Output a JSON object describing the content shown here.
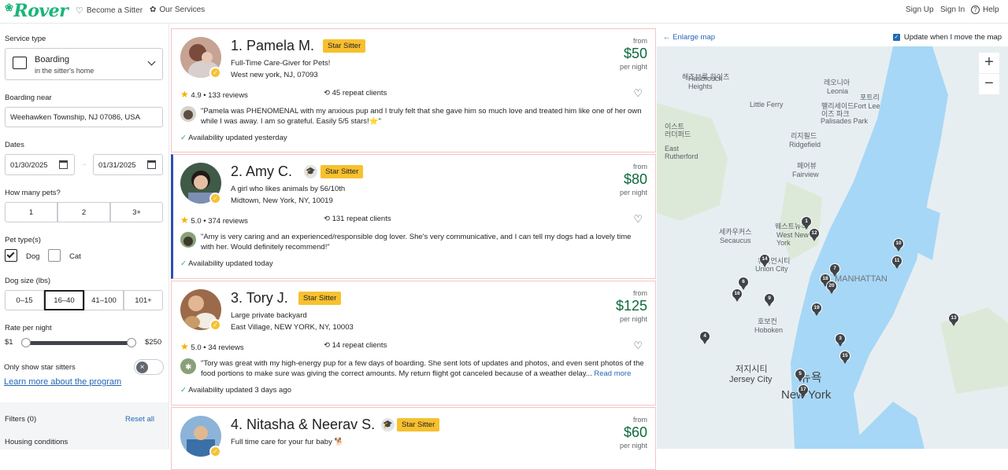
{
  "header": {
    "logo": "Rover",
    "nav_left": [
      "Become a Sitter",
      "Our Services"
    ],
    "nav_right": [
      "Sign Up",
      "Sign In",
      "Help"
    ]
  },
  "filters": {
    "service_type_label": "Service type",
    "service_title": "Boarding",
    "service_subtitle": "in the sitter's home",
    "boarding_near_label": "Boarding near",
    "boarding_near_value": "Weehawken Township, NJ 07086, USA",
    "dates_label": "Dates",
    "date_start": "01/30/2025",
    "date_end": "01/31/2025",
    "date_sep": "→",
    "pets_label": "How many pets?",
    "pets_options": [
      "1",
      "2",
      "3+"
    ],
    "pet_type_label": "Pet type(s)",
    "pet_dog": "Dog",
    "pet_cat": "Cat",
    "dog_size_label": "Dog size (lbs)",
    "dog_sizes": [
      "0–15",
      "16–40",
      "41–100",
      "101+"
    ],
    "selected_size": "16–40",
    "rate_label": "Rate per night",
    "rate_min": "$1",
    "rate_max": "$250",
    "star_only_label": "Only show star sitters",
    "learn_more": "Learn more about the program",
    "filters_count": "Filters (0)",
    "reset_all": "Reset all",
    "housing_label": "Housing conditions"
  },
  "sitters": [
    {
      "name": "1. Pamela M.",
      "badge": "Star Sitter",
      "headline": "Full-Time Care-Giver for Pets!",
      "address": "West new york, NJ, 07093",
      "from": "from",
      "price": "$50",
      "per_night": "per night",
      "rating": "4.9",
      "reviews": "133 reviews",
      "repeat_clients": "45 repeat clients",
      "review_text": "\"Pamela was PHENOMENAL with my anxious pup and I truly felt that she gave him so much love and treated him like one of her own while I was away. I am so grateful. Easily 5/5 stars!⭐\"",
      "availability": "Availability updated yesterday"
    },
    {
      "name": "2. Amy C.",
      "badge": "Star Sitter",
      "headline": "A girl who likes animals by 56/10th",
      "address": "Midtown, New York, NY, 10019",
      "from": "from",
      "price": "$80",
      "per_night": "per night",
      "rating": "5.0",
      "reviews": "374 reviews",
      "repeat_clients": "131 repeat clients",
      "review_text": "\"Amy is very caring and an experienced/responsible dog lover. She's very communicative, and I can tell my dogs had a lovely time with her. Would definitely recommend!\"",
      "availability": "Availability updated today"
    },
    {
      "name": "3. Tory J.",
      "badge": "Star Sitter",
      "headline": "Large private backyard",
      "address": "East Village, NEW YORK, NY, 10003",
      "from": "from",
      "price": "$125",
      "per_night": "per night",
      "rating": "5.0",
      "reviews": "34 reviews",
      "repeat_clients": "14 repeat clients",
      "review_text": "\"Tory was great with my high-energy pup for a few days of boarding. She sent lots of updates and photos, and even sent photos of the food portions to make sure was giving the correct amounts. My return flight got canceled because of a weather delay...",
      "read_more": "Read more",
      "availability": "Availability updated 3 days ago"
    },
    {
      "name": "4. Nitasha & Neerav S.",
      "badge": "Star Sitter",
      "headline": "Full time care for your fur baby 🐕",
      "from": "from",
      "price": "$60",
      "per_night": "per night"
    }
  ],
  "map": {
    "enlarge": "Enlarge map",
    "update_label": "Update when I move the map",
    "zoom_in": "+",
    "zoom_out": "−",
    "pins": [
      "1",
      "12",
      "10",
      "14",
      "7",
      "11",
      "18",
      "20",
      "6",
      "16",
      "9",
      "19",
      "13",
      "4",
      "3",
      "15",
      "5",
      "17"
    ],
    "labels": {
      "hasbrouck": "Hasbrouck\nHeights",
      "hasbrouck_kr": "해즈브룩\n하이츠",
      "leonia_kr": "레오니아",
      "leonia": "Leonia",
      "little_ferry": "Little Ferry",
      "palisades_kr": "팰리세이드\n이즈 파크",
      "palisades": "Palisades Park",
      "fort_lee_kr": "포트리",
      "fort_lee": "Fort Lee",
      "east_rutherford_kr": "이스트\n러더퍼드",
      "east_rutherford": "East\nRutherford",
      "ridgefield_kr": "리지필드",
      "ridgefield": "Ridgefield",
      "fairview_kr": "페어뷰",
      "fairview": "Fairview",
      "secaucus_kr": "세카우커스",
      "secaucus": "Secaucus",
      "west_ny_kr": "웨스트뉴욕",
      "west_ny": "West New\nYork",
      "union_city_kr": "유니언시티",
      "union_city": "Union City",
      "manhattan": "MANHATTAN",
      "hoboken_kr": "호보컨",
      "hoboken": "Hoboken",
      "jersey_city_kr": "저지시티",
      "jersey_city": "Jersey City",
      "new_york_kr": "뉴욕",
      "new_york": "New York"
    }
  }
}
